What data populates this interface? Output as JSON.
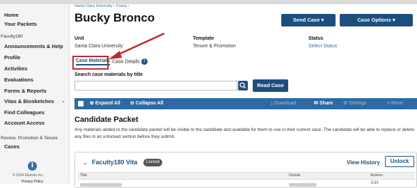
{
  "sidebar": {
    "home": "Home",
    "your_packets": "Your Packets",
    "section_faculty": "Faculty180",
    "announcements": "Announcements & Help",
    "profile": "Profile",
    "activities": "Activities",
    "evaluations": "Evaluations",
    "forms": "Forms & Reports",
    "vitas": "Vitas & Biosketches",
    "find_colleagues": "Find Colleagues",
    "account_access": "Account Access",
    "section_rpt": "Review, Promotion & Tenure",
    "cases": "Cases",
    "copyright": "© 2024 Elsevier Inc.",
    "privacy": "Privacy Policy"
  },
  "header": {
    "breadcrumb": "Santa Clara University  ›  Cases  ›",
    "title": "Bucky Bronco",
    "send_case": "Send Case ▾",
    "case_options": "Case Options ▾"
  },
  "meta": {
    "unit_label": "Unit",
    "unit_value": "Santa Clara University",
    "template_label": "Template",
    "template_value": "Tenure & Promotion",
    "status_label": "Status",
    "status_value": "Select Status"
  },
  "tabs": {
    "case_materials": "Case Materials",
    "case_details": "Case Details",
    "case_details_badge": "1"
  },
  "search": {
    "label": "Search case materials by title",
    "placeholder": "",
    "read_case": "Read Case"
  },
  "toolbar": {
    "expand_all": "Expand All",
    "collapse_all": "Collapse All",
    "download": "Download",
    "share": "Share",
    "settings": "Settings",
    "move": "Move"
  },
  "packet": {
    "title": "Candidate Packet",
    "description": "Any materials added to the candidate packet will be visible to the candidate and available for them to use in their current case. The candidate will be able to replace or delete any files in an unlocked section before they submit."
  },
  "section": {
    "title": "Faculty180 Vita",
    "locked": "Locked",
    "view_history": "View History",
    "unlock": "Unlock",
    "columns": [
      "Title",
      "Details",
      "Actions"
    ],
    "edit": "Edit"
  },
  "colors": {
    "primary": "#1d4f7e",
    "toolbar": "#2d6aa3",
    "highlight": "#c0262a"
  }
}
